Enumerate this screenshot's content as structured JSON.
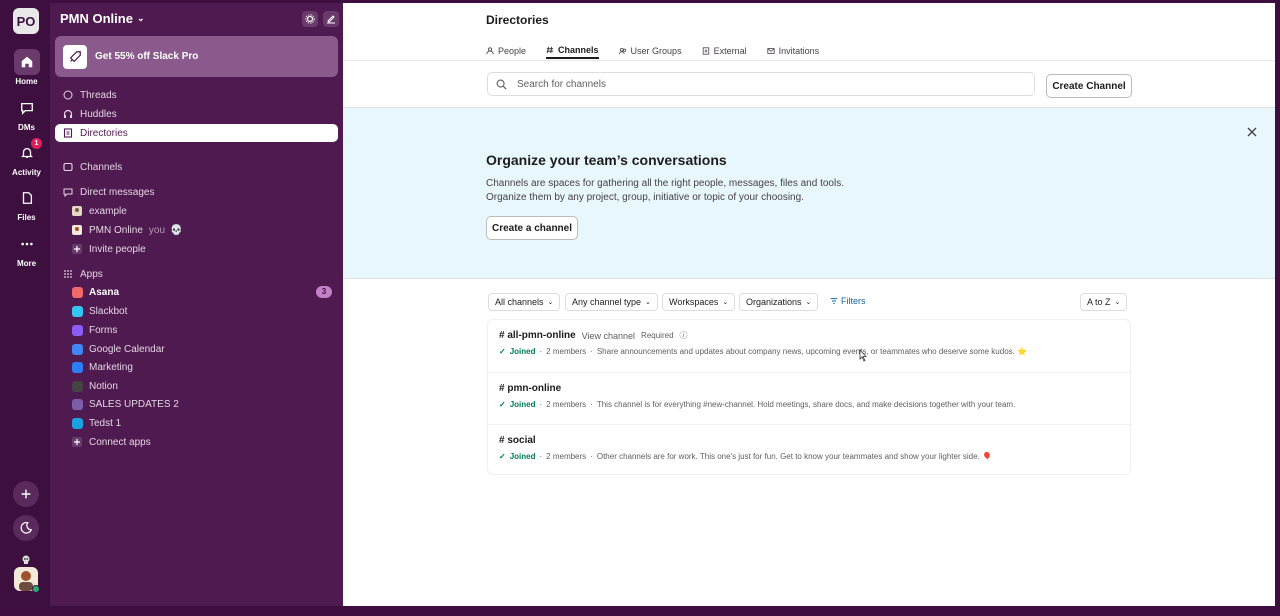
{
  "workspace": {
    "initials": "PO",
    "name": "PMN Online"
  },
  "rail": {
    "items": [
      {
        "label": "Home",
        "icon": "home-icon"
      },
      {
        "label": "DMs",
        "icon": "dms-icon"
      },
      {
        "label": "Activity",
        "icon": "bell-icon",
        "badge": "1"
      },
      {
        "label": "Files",
        "icon": "files-icon"
      },
      {
        "label": "More",
        "icon": "more-icon"
      }
    ]
  },
  "sidebar": {
    "promo": "Get 55% off Slack Pro",
    "top_items": [
      {
        "label": "Threads",
        "icon": "threads-icon"
      },
      {
        "label": "Huddles",
        "icon": "headphones-icon"
      },
      {
        "label": "Directories",
        "icon": "directory-icon"
      }
    ],
    "channels_label": "Channels",
    "dm_label": "Direct messages",
    "dms": [
      {
        "label": "example"
      },
      {
        "label": "PMN Online",
        "suffix": "you"
      }
    ],
    "invite_label": "Invite people",
    "apps_label": "Apps",
    "apps": [
      {
        "label": "Asana",
        "badge": "3",
        "color": "#f06a6a"
      },
      {
        "label": "Slackbot",
        "color": "#36c5f0"
      },
      {
        "label": "Forms",
        "color": "#8b5cf6"
      },
      {
        "label": "Google Calendar",
        "color": "#4285f4"
      },
      {
        "label": "Marketing",
        "color": "#2d7ff9"
      },
      {
        "label": "Notion",
        "color": "#444444"
      },
      {
        "label": "SALES UPDATES 2",
        "color": "#7b5ea7"
      },
      {
        "label": "Tedst 1",
        "color": "#1ba0e0"
      }
    ],
    "connect_label": "Connect apps"
  },
  "main": {
    "title": "Directories",
    "tabs": [
      {
        "label": "People",
        "icon": "person-icon"
      },
      {
        "label": "Channels",
        "icon": "hash-icon"
      },
      {
        "label": "User Groups",
        "icon": "group-icon"
      },
      {
        "label": "External",
        "icon": "building-icon"
      },
      {
        "label": "Invitations",
        "icon": "mail-icon"
      }
    ],
    "search_placeholder": "Search for channels",
    "create_channel_btn": "Create Channel",
    "banner": {
      "title": "Organize your team’s conversations",
      "line1": "Channels are spaces for gathering all the right people, messages, files and tools.",
      "line2": "Organize them by any project, group, initiative or topic of your choosing.",
      "button": "Create a channel"
    },
    "filters": {
      "all_channels": "All channels",
      "channel_type": "Any channel type",
      "workspaces": "Workspaces",
      "organizations": "Organizations",
      "filters": "Filters",
      "sort": "A to Z"
    },
    "channels": [
      {
        "name": "# all-pmn-online",
        "view": "View channel",
        "required": "Required",
        "joined": "Joined",
        "members": "2 members",
        "desc": "Share announcements and updates about company news, upcoming events, or teammates who deserve some kudos. ⭐"
      },
      {
        "name": "# pmn-online",
        "joined": "Joined",
        "members": "2 members",
        "desc": "This channel is for everything #new-channel. Hold meetings, share docs, and make decisions together with your team."
      },
      {
        "name": "# social",
        "joined": "Joined",
        "members": "2 members",
        "desc": "Other channels are for work. This one's just for fun. Get to know your teammates and show your lighter side. 🎈"
      }
    ]
  }
}
